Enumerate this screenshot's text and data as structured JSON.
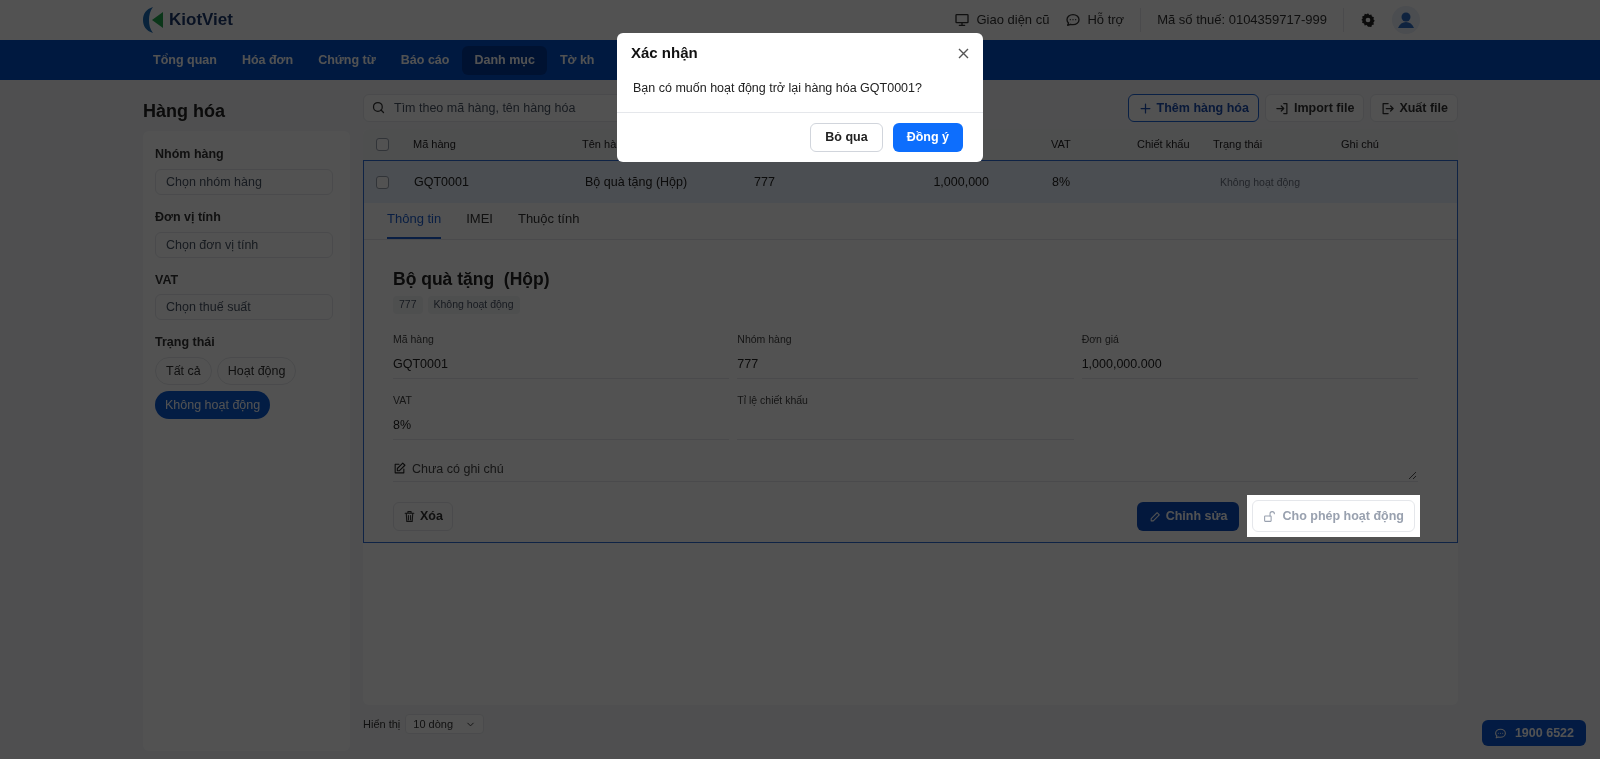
{
  "header": {
    "brand": "KiotViet",
    "links": [
      {
        "kind": "monitor",
        "label": "Giao diện cũ"
      },
      {
        "kind": "chat",
        "label": "Hỗ trợ"
      }
    ],
    "tax_id": "Mã số thuế: 0104359717-999"
  },
  "nav": [
    {
      "label": "Tổng quan",
      "selected": false
    },
    {
      "label": "Hóa đơn",
      "selected": false
    },
    {
      "label": "Chứng từ",
      "selected": false
    },
    {
      "label": "Báo cáo",
      "selected": false
    },
    {
      "label": "Danh mục",
      "selected": true
    },
    {
      "label": "Tờ kh",
      "selected": false
    }
  ],
  "page_title": "Hàng hóa",
  "filters": [
    {
      "kind": "select",
      "label": "Nhóm hàng",
      "placeholder": "Chọn nhóm hàng"
    },
    {
      "kind": "select",
      "label": "Đơn vị tính",
      "placeholder": "Chọn đơn vị tính"
    },
    {
      "kind": "select",
      "label": "VAT",
      "placeholder": "Chọn thuế suất"
    },
    {
      "kind": "chips",
      "label": "Trạng thái",
      "options": [
        {
          "label": "Tất cả",
          "selected": false
        },
        {
          "label": "Hoạt động",
          "selected": false
        },
        {
          "label": "Không hoạt động",
          "selected": true
        }
      ]
    }
  ],
  "search": {
    "placeholder": "Tìm theo mã hàng, tên hàng hóa"
  },
  "actions": [
    {
      "kind": "add",
      "label": "Thêm hàng hóa"
    },
    {
      "kind": "import",
      "label": "Import file"
    },
    {
      "kind": "export",
      "label": "Xuất file"
    }
  ],
  "table": {
    "all_checked": false,
    "columns": {
      "code": "Mã hàng",
      "name": "Tên hà",
      "vat": "VAT",
      "discount": "Chiết khấu",
      "status": "Trạng thái",
      "note": "Ghi chú"
    },
    "rows": [
      {
        "checked": false,
        "code": "GQT0001",
        "name": "Bộ quà tặng (Hộp)",
        "group": "777",
        "price": "1,000,000",
        "vat": "8%",
        "status": "Không hoạt động"
      }
    ]
  },
  "detail": {
    "tabs": [
      {
        "label": "Thông tin",
        "selected": true
      },
      {
        "label": "IMEI",
        "selected": false
      },
      {
        "label": "Thuộc tính",
        "selected": false
      }
    ],
    "title": "Bộ quà tặng  (Hộp)",
    "tags": [
      "777",
      "Không hoạt động"
    ],
    "fields": [
      {
        "label": "Mã hàng",
        "value": "GQT0001"
      },
      {
        "label": "Nhóm hàng",
        "value": "777"
      },
      {
        "label": "Đơn giá",
        "value": "1,000,000.000"
      },
      {
        "label": "VAT",
        "value": "8%"
      },
      {
        "label": "Tỉ lệ chiết khấu"
      }
    ],
    "note_placeholder": "Chưa có ghi chú",
    "delete": "Xóa",
    "edit": "Chỉnh sửa",
    "activate": "Cho phép hoạt động"
  },
  "pager": {
    "label": "Hiển thị",
    "page_size": "10 dòng"
  },
  "hotline": "1900 6522",
  "dialog": {
    "title": "Xác nhận",
    "message": "Bạn có muốn hoạt động trở lại hàng hóa GQT0001?",
    "buttons": [
      {
        "kind": "cancel",
        "label": "Bỏ qua"
      },
      {
        "kind": "confirm",
        "label": "Đồng ý"
      }
    ]
  }
}
